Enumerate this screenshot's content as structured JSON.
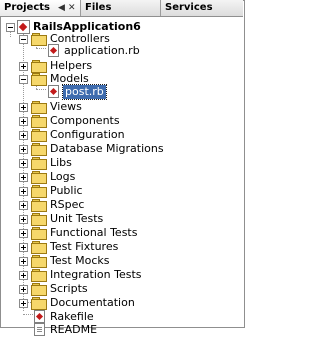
{
  "tabs": {
    "projects": "Projects",
    "minimize_glyph": "◀",
    "close_glyph": "✕",
    "files": "Files",
    "services": "Services"
  },
  "tree": {
    "project": "RailsApplication6",
    "controllers": "Controllers",
    "application_rb": "application.rb",
    "helpers": "Helpers",
    "models": "Models",
    "post_rb": "post.rb",
    "views": "Views",
    "components": "Components",
    "configuration": "Configuration",
    "database_migrations": "Database Migrations",
    "libs": "Libs",
    "logs": "Logs",
    "public": "Public",
    "rspec": "RSpec",
    "unit_tests": "Unit Tests",
    "functional_tests": "Functional Tests",
    "test_fixtures": "Test Fixtures",
    "test_mocks": "Test Mocks",
    "integration_tests": "Integration Tests",
    "scripts": "Scripts",
    "documentation": "Documentation",
    "rakefile": "Rakefile",
    "readme": "README"
  },
  "colors": {
    "selection": "#3f6cae",
    "folder": "#f6d86b",
    "ruby": "#c21a1a"
  }
}
